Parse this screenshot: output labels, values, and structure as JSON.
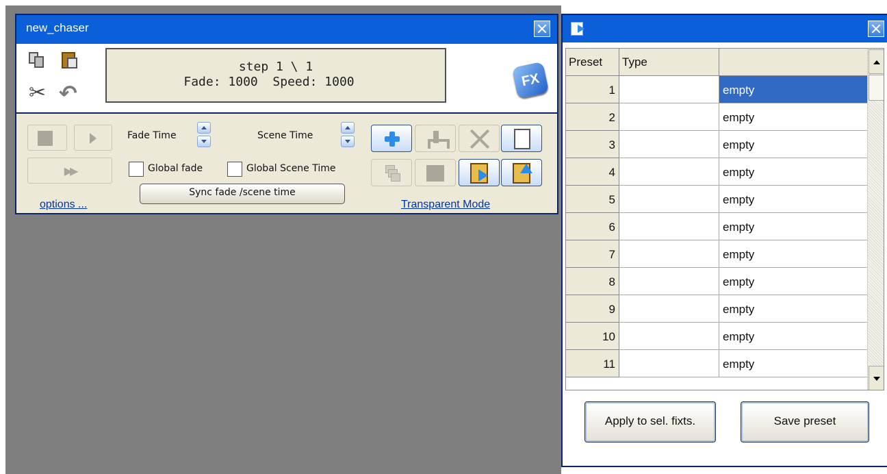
{
  "chaser": {
    "title": "new_chaser",
    "lcd_line1": "step 1 \\ 1",
    "lcd_line2": "Fade: 1000  Speed: 1000",
    "fx_label": "FX",
    "fade_time_label": "Fade Time",
    "scene_time_label": "Scene Time",
    "global_fade_label": "Global fade",
    "global_scene_time_label": "Global Scene Time",
    "sync_button_label": "Sync fade /scene time",
    "options_link": "options ...",
    "transparent_mode_link": "Transparent Mode"
  },
  "preset_panel": {
    "columns": [
      "Preset",
      "Type",
      ""
    ],
    "rows": [
      {
        "preset": "1",
        "type": "",
        "value": "empty"
      },
      {
        "preset": "2",
        "type": "",
        "value": "empty"
      },
      {
        "preset": "3",
        "type": "",
        "value": "empty"
      },
      {
        "preset": "4",
        "type": "",
        "value": "empty"
      },
      {
        "preset": "5",
        "type": "",
        "value": "empty"
      },
      {
        "preset": "6",
        "type": "",
        "value": "empty"
      },
      {
        "preset": "7",
        "type": "",
        "value": "empty"
      },
      {
        "preset": "8",
        "type": "",
        "value": "empty"
      },
      {
        "preset": "9",
        "type": "",
        "value": "empty"
      },
      {
        "preset": "10",
        "type": "",
        "value": "empty"
      },
      {
        "preset": "11",
        "type": "",
        "value": "empty"
      }
    ],
    "selected_row": 1,
    "apply_button_label": "Apply to sel. fixts.",
    "save_button_label": "Save preset"
  },
  "icons": [
    "copy-icon",
    "paste-icon",
    "cut-icon",
    "undo-icon",
    "fx-icon",
    "stop-icon",
    "play-icon",
    "fast-forward-icon",
    "plus-icon",
    "tree-icon",
    "delete-icon",
    "new-icon",
    "stack-icon",
    "square-icon",
    "import-icon",
    "export-icon",
    "window-icon",
    "close-icon"
  ],
  "colors": {
    "titlebar": "#0b5fd8",
    "selection": "#316ac5",
    "link": "#0033aa",
    "workspace": "#7f7f7f"
  }
}
